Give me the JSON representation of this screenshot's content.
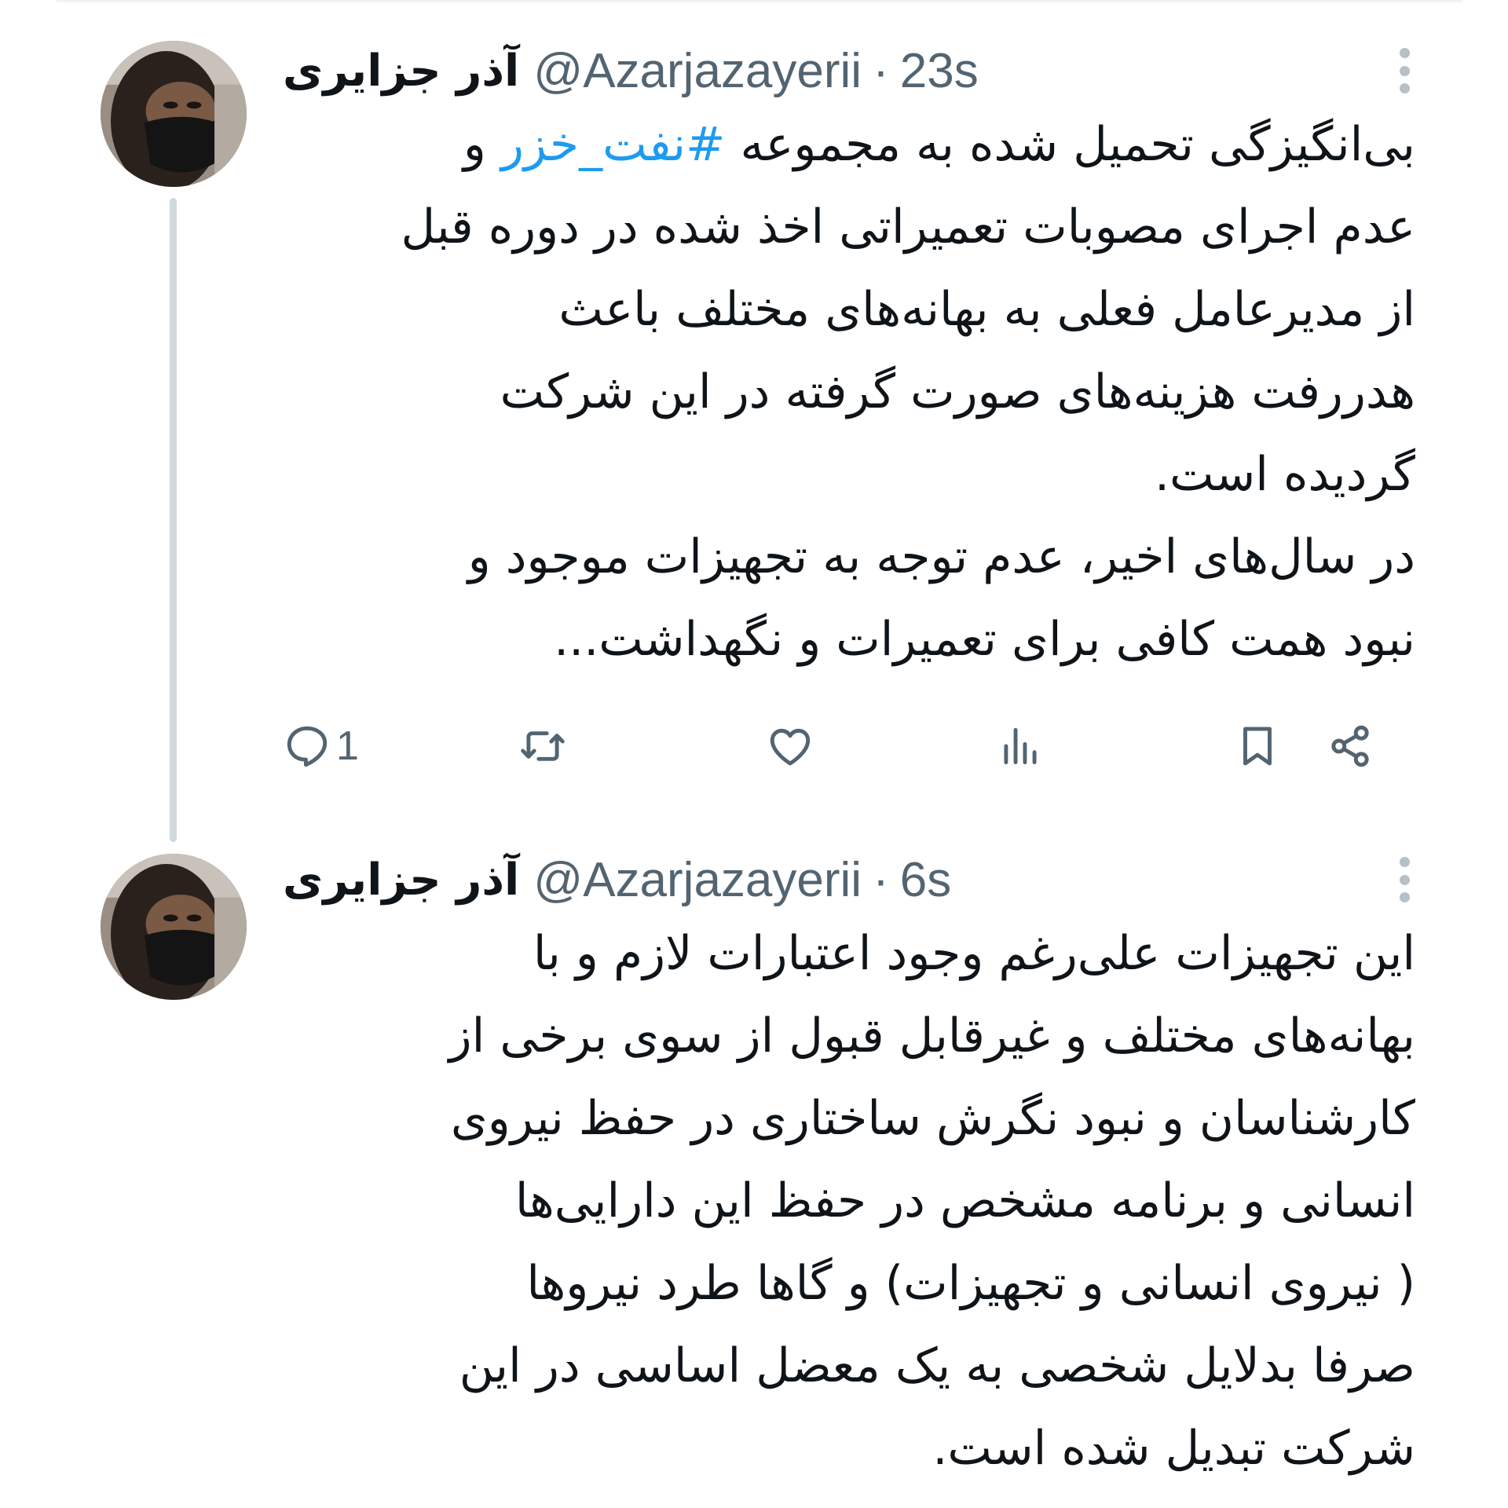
{
  "tweets": [
    {
      "display_name": "آذر جزایری",
      "handle": "@Azarjazayerii",
      "separator": "·",
      "time": "23s",
      "text_lines": [
        {
          "before": "بی‌انگیزگی تحمیل شده به مجموعه ",
          "hashtag": "#نفت_خزر",
          "after": " و"
        },
        {
          "text": "عدم اجرای مصوبات تعمیراتی اخذ شده در دوره قبل"
        },
        {
          "text": "از مدیرعامل فعلی به بهانه‌های مختلف باعث"
        },
        {
          "text": "هدررفت هزینه‌های صورت گرفته در این شرکت"
        },
        {
          "text": "گردیده است."
        },
        {
          "text": "در سال‌های اخیر، عدم توجه به تجهیزات موجود و"
        },
        {
          "text": "نبود همت کافی برای تعمیرات و نگهداشت..."
        }
      ],
      "actions": {
        "reply_icon": "reply-icon",
        "reply_count": "1",
        "retweet_icon": "retweet-icon",
        "like_icon": "heart-icon",
        "views_icon": "views-icon",
        "bookmark_icon": "bookmark-icon",
        "share_icon": "share-icon"
      }
    },
    {
      "display_name": "آذر جزایری",
      "handle": "@Azarjazayerii",
      "separator": "·",
      "time": "6s",
      "text_lines": [
        {
          "text": "این تجهیزات علی‌رغم وجود اعتبارات لازم و با"
        },
        {
          "text": "بهانه‌های مختلف و غیرقابل قبول از سوی برخی از"
        },
        {
          "text": "کارشناسان و نبود نگرش ساختاری در حفظ نیروی"
        },
        {
          "text": "انسانی و برنامه مشخص در حفظ این دارایی‌ها"
        },
        {
          "text": "( نیروی انسانی و تجهیزات) و گاها طرد نیروها"
        },
        {
          "text": "صرفا بدلایل شخصی به یک معضل اساسی در این"
        },
        {
          "text": "شرکت تبدیل شده است."
        }
      ]
    }
  ],
  "colors": {
    "accent": "#1d9bf0",
    "text": "#0f1419",
    "secondary": "#536471",
    "thread_line": "#cfd9de"
  }
}
